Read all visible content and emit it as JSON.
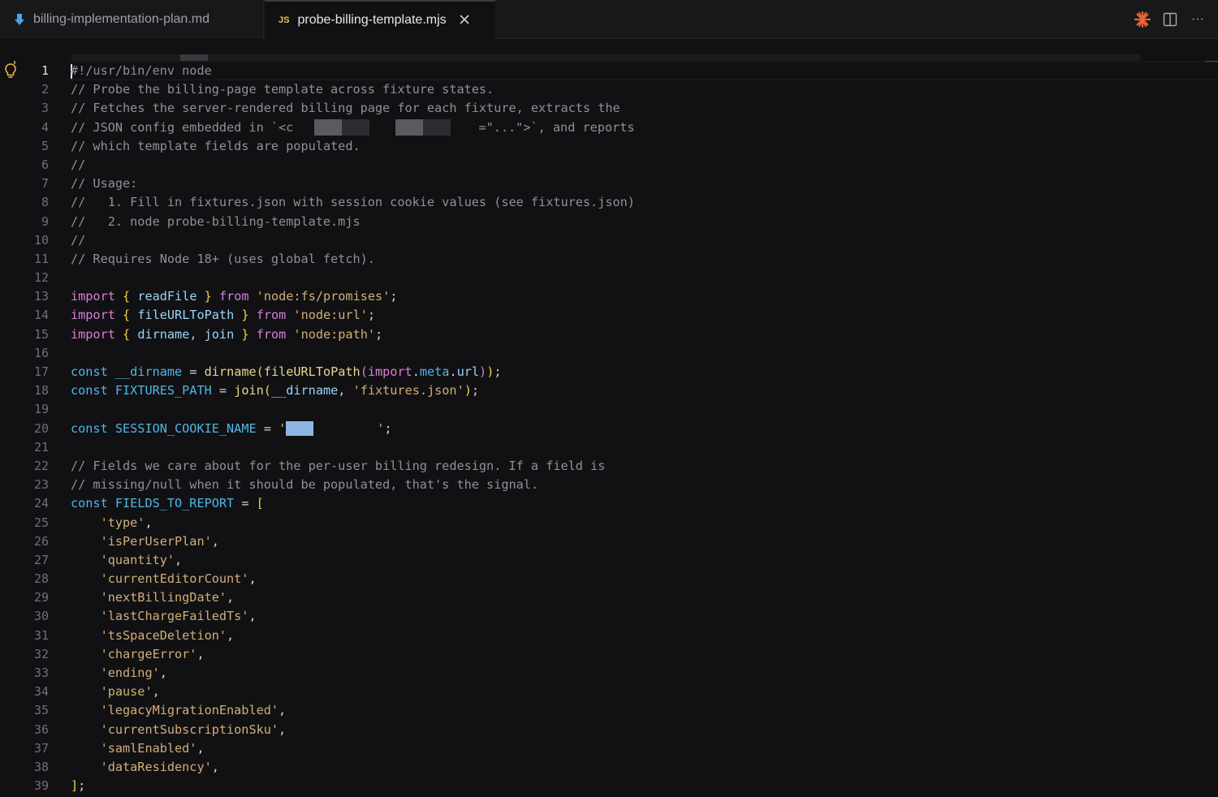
{
  "tabs": [
    {
      "label": "billing-implementation-plan.md",
      "icon": "markdown-download-icon",
      "active": false
    },
    {
      "label": "probe-billing-template.mjs",
      "icon": "js-icon",
      "badge": "JS",
      "active": true
    }
  ],
  "tab_actions": [
    {
      "name": "sparkle-icon",
      "color": "#e8643c"
    },
    {
      "name": "split-editor-icon"
    },
    {
      "name": "more-actions-icon",
      "glyph": "···"
    }
  ],
  "editor": {
    "active_line": 1,
    "line_numbers": [
      "1",
      "2",
      "3",
      "4",
      "5",
      "6",
      "7",
      "8",
      "9",
      "10",
      "11",
      "12",
      "13",
      "14",
      "15",
      "16",
      "17",
      "18",
      "19",
      "20",
      "21",
      "22",
      "23",
      "24",
      "25",
      "26",
      "27",
      "28",
      "29",
      "30",
      "31",
      "32",
      "33",
      "34",
      "35",
      "36",
      "37",
      "38",
      "39"
    ],
    "code": {
      "l1": "#!/usr/bin/env node",
      "l2": "// Probe the billing-page template across fixture states.",
      "l3": "// Fetches the server-rendered billing page for each fixture, extracts the",
      "l4a": "// JSON config embedded in `<c",
      "l4b": "=\"...\">`, and reports",
      "l5": "// which template fields are populated.",
      "l6": "//",
      "l7": "// Usage:",
      "l8": "//   1. Fill in fixtures.json with session cookie values (see fixtures.json)",
      "l9": "//   2. node probe-billing-template.mjs",
      "l10": "//",
      "l11": "// Requires Node 18+ (uses global fetch).",
      "import_kw": "import",
      "from_kw": "from",
      "const_kw": "const",
      "l13_name": "readFile",
      "l13_src": "'node:fs/promises'",
      "l14_name": "fileURLToPath",
      "l14_src": "'node:url'",
      "l15_name": "dirname, join",
      "l15_src": "'node:path'",
      "l17_var": "__dirname",
      "l17_fn1": "dirname",
      "l17_fn2": "fileURLToPath",
      "l17_import": "import",
      "l17_meta": "meta",
      "l17_url": "url",
      "l18_var": "FIXTURES_PATH",
      "l18_fn": "join",
      "l18_arg": "__dirname",
      "l18_str": "'fixtures.json'",
      "l20_var": "SESSION_COOKIE_NAME",
      "l22": "// Fields we care about for the per-user billing redesign. If a field is",
      "l23": "// missing/null when it should be populated, that's the signal.",
      "l24_var": "FIELDS_TO_REPORT",
      "fields": [
        "'type'",
        "'isPerUserPlan'",
        "'quantity'",
        "'currentEditorCount'",
        "'nextBillingDate'",
        "'lastChargeFailedTs'",
        "'tsSpaceDeletion'",
        "'chargeError'",
        "'ending'",
        "'pause'",
        "'legacyMigrationEnabled'",
        "'currentSubscriptionSku'",
        "'samlEnabled'",
        "'dataResidency'"
      ]
    }
  },
  "colors": {
    "background": "#111113",
    "comment": "#8f9198",
    "keyword": "#d97ed8",
    "declaration": "#4fb6e8",
    "function": "#e6d792",
    "string": "#d2ae7a",
    "bracket": "#f0d24a"
  }
}
